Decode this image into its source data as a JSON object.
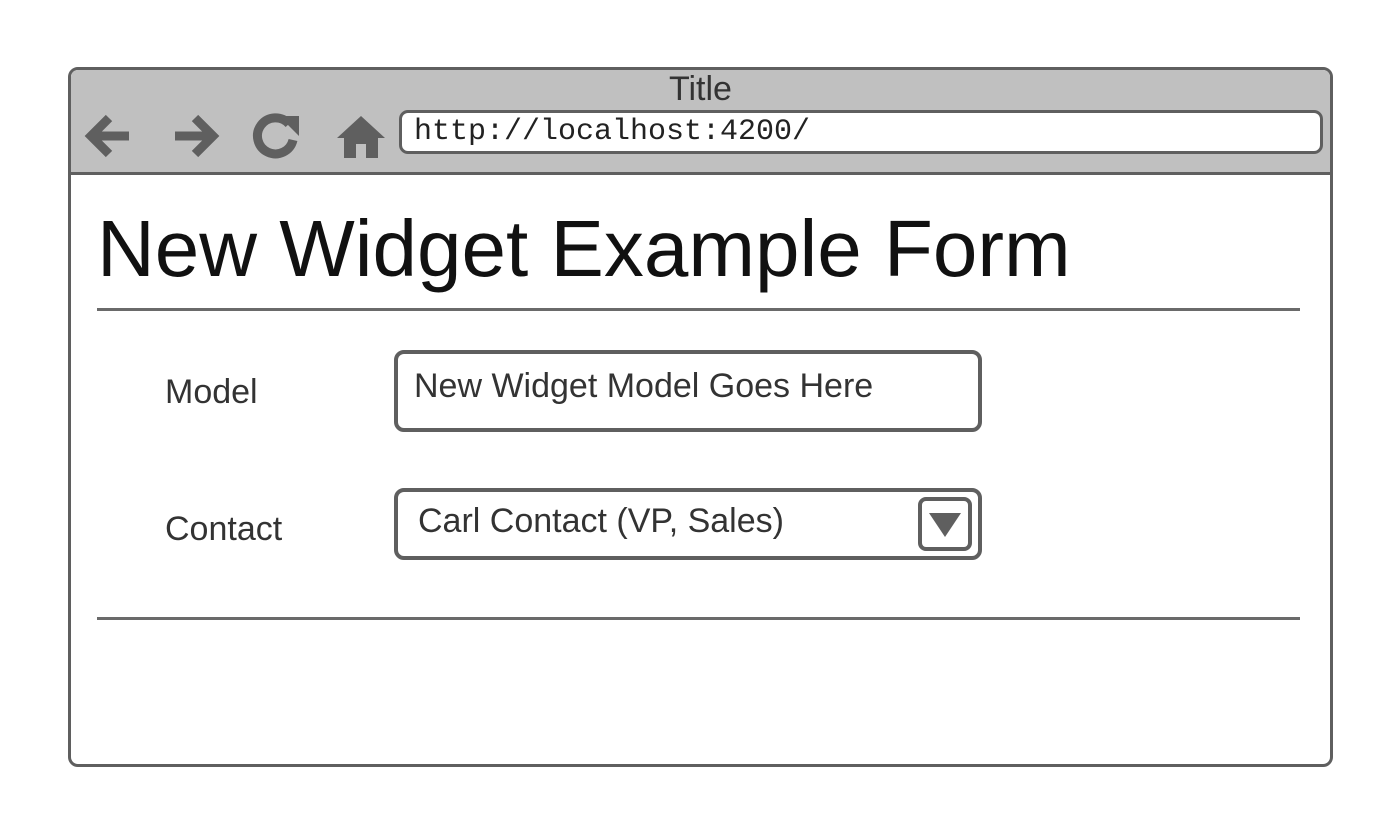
{
  "window": {
    "title": "Title",
    "address_bar": {
      "url": "http://localhost:4200/"
    },
    "nav_icons": [
      "back-arrow-icon",
      "forward-arrow-icon",
      "refresh-icon",
      "home-icon"
    ]
  },
  "page": {
    "title": "New Widget Example Form"
  },
  "form": {
    "model": {
      "label": "Model",
      "value": "New Widget Model Goes Here"
    },
    "contact": {
      "label": "Contact",
      "value": "Carl Contact (VP, Sales)"
    }
  },
  "colors": {
    "chrome": "#c0c0c0",
    "border": "#5f5f5f",
    "background": "#ffffff"
  }
}
